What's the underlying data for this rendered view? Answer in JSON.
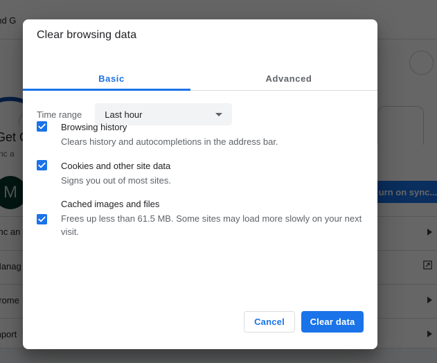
{
  "dialog": {
    "title": "Clear browsing data",
    "tabs": [
      {
        "label": "Basic",
        "active": true
      },
      {
        "label": "Advanced",
        "active": false
      }
    ],
    "time_range": {
      "label": "Time range",
      "value": "Last hour"
    },
    "options": [
      {
        "title": "Browsing history",
        "description": "Clears history and autocompletions in the address bar.",
        "checked": true
      },
      {
        "title": "Cookies and other site data",
        "description": "Signs you out of most sites.",
        "checked": true
      },
      {
        "title": "Cached images and files",
        "description": "Frees up less than 61.5 MB. Some sites may load more slowly on your next visit.",
        "checked": true
      }
    ],
    "footer": {
      "cancel_label": "Cancel",
      "confirm_label": "Clear data"
    }
  },
  "background": {
    "section_heading": "and G",
    "promo_title": "Get G",
    "promo_sub": "ync a",
    "avatar_letter": "M",
    "sync_button_label": "urn on sync...",
    "rows": [
      "ync an",
      "Manag",
      "hrome",
      "mport"
    ]
  },
  "colors": {
    "accent": "#1a73e8",
    "text_primary": "#202124",
    "text_secondary": "#5f6368",
    "divider": "#dadce0",
    "field_bg": "#f1f3f4",
    "avatar_bg": "#0b3b2e"
  }
}
